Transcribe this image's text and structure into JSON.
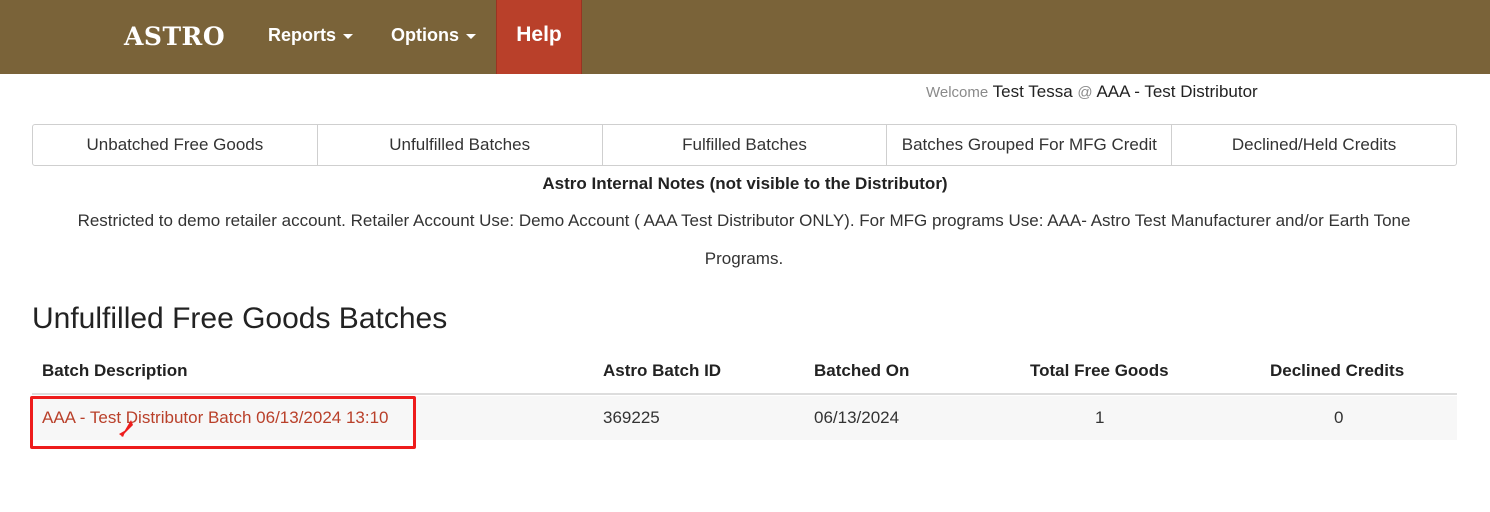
{
  "nav": {
    "logo": "ASTRO",
    "reports": "Reports",
    "options": "Options",
    "help": "Help"
  },
  "welcome": {
    "prefix": "Welcome",
    "user": "Test Tessa",
    "at": "@",
    "distributor": "AAA - Test Distributor"
  },
  "tabs": [
    "Unbatched Free Goods",
    "Unfulfilled Batches",
    "Fulfilled Batches",
    "Batches Grouped For MFG Credit",
    "Declined/Held Credits"
  ],
  "notes": {
    "title": "Astro Internal Notes (not visible to the Distributor)",
    "text": "Restricted to demo retailer account. Retailer Account Use: Demo Account ( AAA Test Distributor ONLY). For MFG programs Use: AAA- Astro Test Manufacturer and/or Earth Tone Programs."
  },
  "section_title": "Unfulfilled Free Goods Batches",
  "table": {
    "headers": [
      "Batch Description",
      "Astro Batch ID",
      "Batched On",
      "Total Free Goods",
      "Declined Credits"
    ],
    "rows": [
      {
        "description": "AAA - Test Distributor Batch 06/13/2024 13:10",
        "batch_id": "369225",
        "batched_on": "06/13/2024",
        "total_free_goods": "1",
        "declined_credits": "0"
      }
    ]
  },
  "colors": {
    "navbar": "#7a6339",
    "help_active": "#b9402a",
    "link": "#b9402a",
    "highlight": "#ee1c1c"
  }
}
